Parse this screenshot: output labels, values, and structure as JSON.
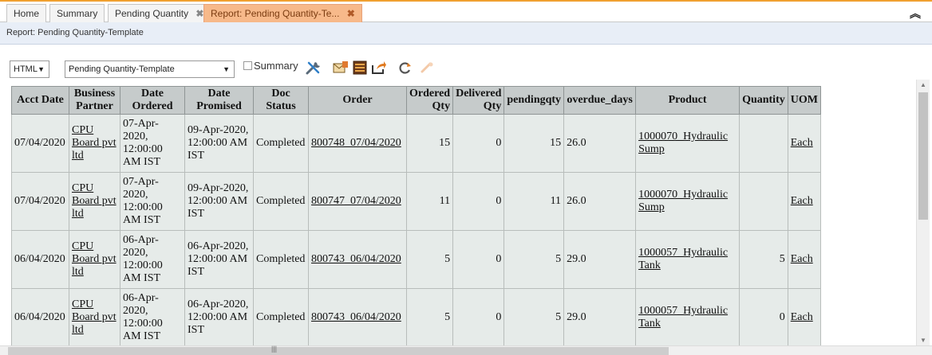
{
  "tabs": [
    {
      "label": "Home",
      "closable": false,
      "active": false
    },
    {
      "label": "Summary",
      "closable": false,
      "active": false
    },
    {
      "label": "Pending Quantity",
      "closable": true,
      "active": false
    },
    {
      "label": "Report: Pending Quantity-Te...",
      "closable": true,
      "active": true
    }
  ],
  "tab_close_glyph": "✖",
  "collapse_glyph": "︽",
  "report_header": "Report: Pending Quantity-Template",
  "toolbar": {
    "format_select": "HTML",
    "template_select": "Pending Quantity-Template",
    "summary_label": "Summary",
    "summary_checked": false,
    "icons": [
      "customize-icon",
      "export-mail-icon",
      "archive-icon",
      "send-icon",
      "refresh-icon",
      "disabled-action-icon"
    ]
  },
  "table": {
    "columns": [
      "Acct Date",
      "Business Partner",
      "Date Ordered",
      "Date Promised",
      "Doc Status",
      "Order",
      "Ordered Qty",
      "Delivered Qty",
      "pendingqty",
      "overdue_days",
      "Product",
      "Quantity",
      "UOM"
    ],
    "rows": [
      {
        "acct_date": "07/04/2020",
        "partner": "CPU Board pvt ltd",
        "date_ordered": "07-Apr-2020, 12:00:00 AM IST",
        "date_promised": "09-Apr-2020, 12:00:00 AM IST",
        "doc_status": "Completed",
        "order": "800748_07/04/2020",
        "ordered_qty": "15",
        "delivered_qty": "0",
        "pendingqty": "15",
        "overdue_days": "26.0",
        "product": "1000070_Hydraulic Sump",
        "quantity": "",
        "uom": "Each"
      },
      {
        "acct_date": "07/04/2020",
        "partner": "CPU Board pvt ltd",
        "date_ordered": "07-Apr-2020, 12:00:00 AM IST",
        "date_promised": "09-Apr-2020, 12:00:00 AM IST",
        "doc_status": "Completed",
        "order": "800747_07/04/2020",
        "ordered_qty": "11",
        "delivered_qty": "0",
        "pendingqty": "11",
        "overdue_days": "26.0",
        "product": "1000070_Hydraulic Sump",
        "quantity": "",
        "uom": "Each"
      },
      {
        "acct_date": "06/04/2020",
        "partner": "CPU Board pvt ltd",
        "date_ordered": "06-Apr-2020, 12:00:00 AM IST",
        "date_promised": "06-Apr-2020, 12:00:00 AM IST",
        "doc_status": "Completed",
        "order": "800743_06/04/2020",
        "ordered_qty": "5",
        "delivered_qty": "0",
        "pendingqty": "5",
        "overdue_days": "29.0",
        "product": "1000057_Hydraulic Tank",
        "quantity": "5",
        "uom": "Each"
      },
      {
        "acct_date": "06/04/2020",
        "partner": "CPU Board pvt ltd",
        "date_ordered": "06-Apr-2020, 12:00:00 AM IST",
        "date_promised": "06-Apr-2020, 12:00:00 AM IST",
        "doc_status": "Completed",
        "order": "800743_06/04/2020",
        "ordered_qty": "5",
        "delivered_qty": "0",
        "pendingqty": "5",
        "overdue_days": "29.0",
        "product": "1000057_Hydraulic Tank",
        "quantity": "0",
        "uom": "Each"
      }
    ]
  },
  "colors": {
    "tab_accent": "#f0a030",
    "active_tab_bg": "#f7b98a",
    "header_strip_bg": "#e8eef7",
    "table_header_bg": "#c6cbcb",
    "table_cell_bg": "#e6ebe9"
  }
}
